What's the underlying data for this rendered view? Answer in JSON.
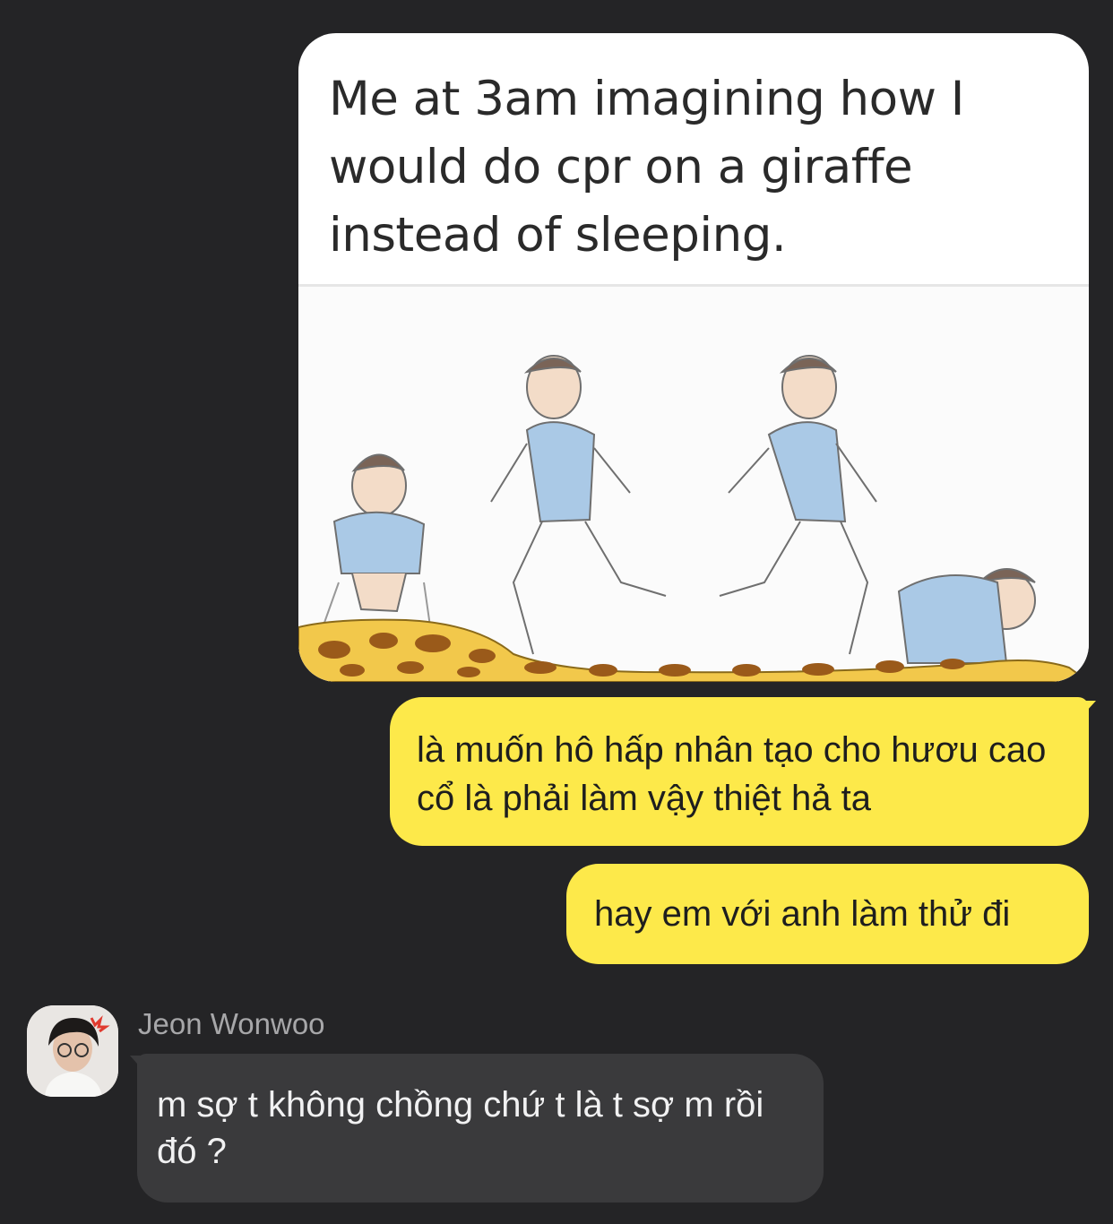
{
  "messages": {
    "meme": {
      "caption": "Me at 3am imagining how I would do cpr on a giraffe instead of sleeping."
    },
    "outgoing": [
      {
        "text": "là muốn hô hấp nhân tạo cho hươu cao cổ là phải làm vậy thiệt hả ta"
      },
      {
        "text": "hay em với anh làm thử đi"
      }
    ],
    "incoming": {
      "sender": "Jeon Wonwoo",
      "text": "m sợ t không chồng chứ t là t sợ m rồi đó ?"
    }
  },
  "colors": {
    "background": "#242426",
    "outgoing_bubble": "#fde94a",
    "incoming_bubble": "#3a3a3c",
    "sender_name": "#a7a7a9"
  }
}
